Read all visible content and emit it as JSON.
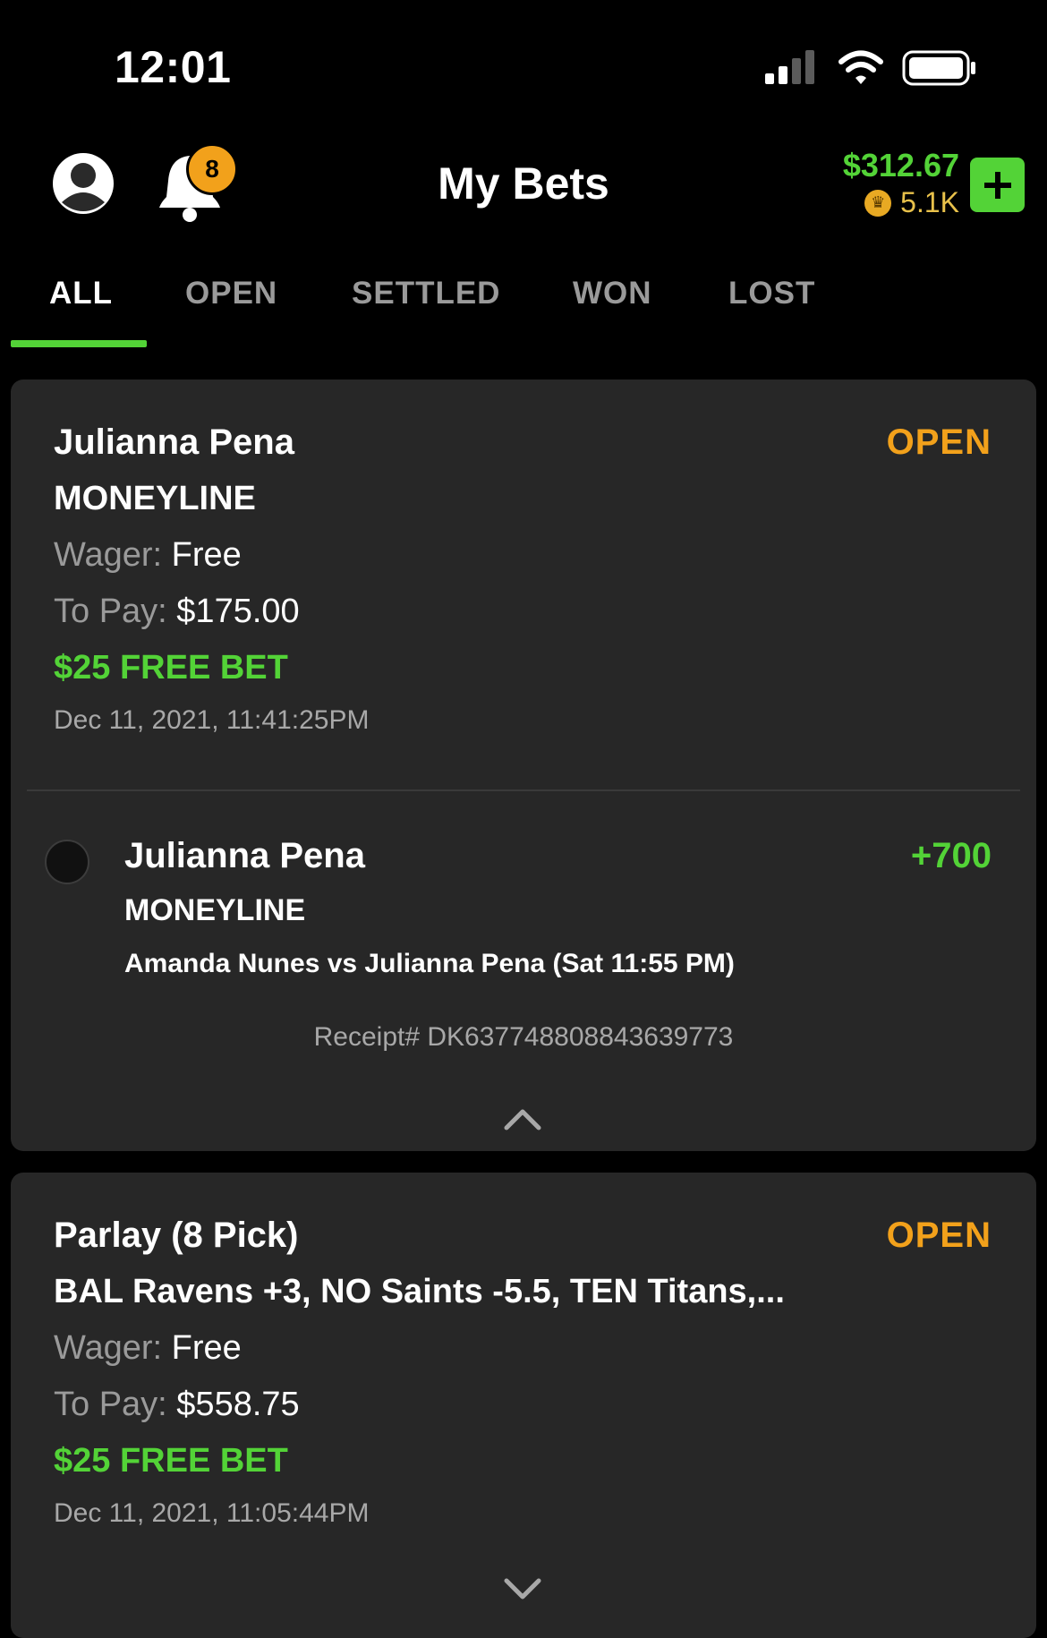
{
  "status_bar": {
    "time": "12:01"
  },
  "header": {
    "title": "My Bets",
    "notification_count": "8",
    "balance": "$312.67",
    "coins": "5.1K"
  },
  "tabs": [
    "ALL",
    "OPEN",
    "SETTLED",
    "WON",
    "LOST"
  ],
  "active_tab": "ALL",
  "bets": [
    {
      "title": "Julianna Pena",
      "subtitle": "MONEYLINE",
      "status": "OPEN",
      "wager_label": "Wager:",
      "wager_value": "Free",
      "topay_label": "To Pay:",
      "topay_value": "$175.00",
      "promo": "$25 FREE BET",
      "date": "Dec 11, 2021, 11:41:25PM",
      "selection": {
        "name": "Julianna Pena",
        "market": "MONEYLINE",
        "odds": "+700",
        "event": "Amanda Nunes vs Julianna Pena (Sat 11:55 PM)"
      },
      "receipt": "Receipt# DK637748808843639773"
    },
    {
      "title": "Parlay (8 Pick)",
      "subtitle": "BAL Ravens +3, NO Saints -5.5, TEN Titans,...",
      "status": "OPEN",
      "wager_label": "Wager:",
      "wager_value": "Free",
      "topay_label": "To Pay:",
      "topay_value": "$558.75",
      "promo": "$25 FREE BET",
      "date": "Dec 11, 2021, 11:05:44PM"
    }
  ],
  "colors": {
    "accent": "#53d337",
    "open_status": "#f2a11b",
    "card": "#272727",
    "background": "#000000"
  }
}
